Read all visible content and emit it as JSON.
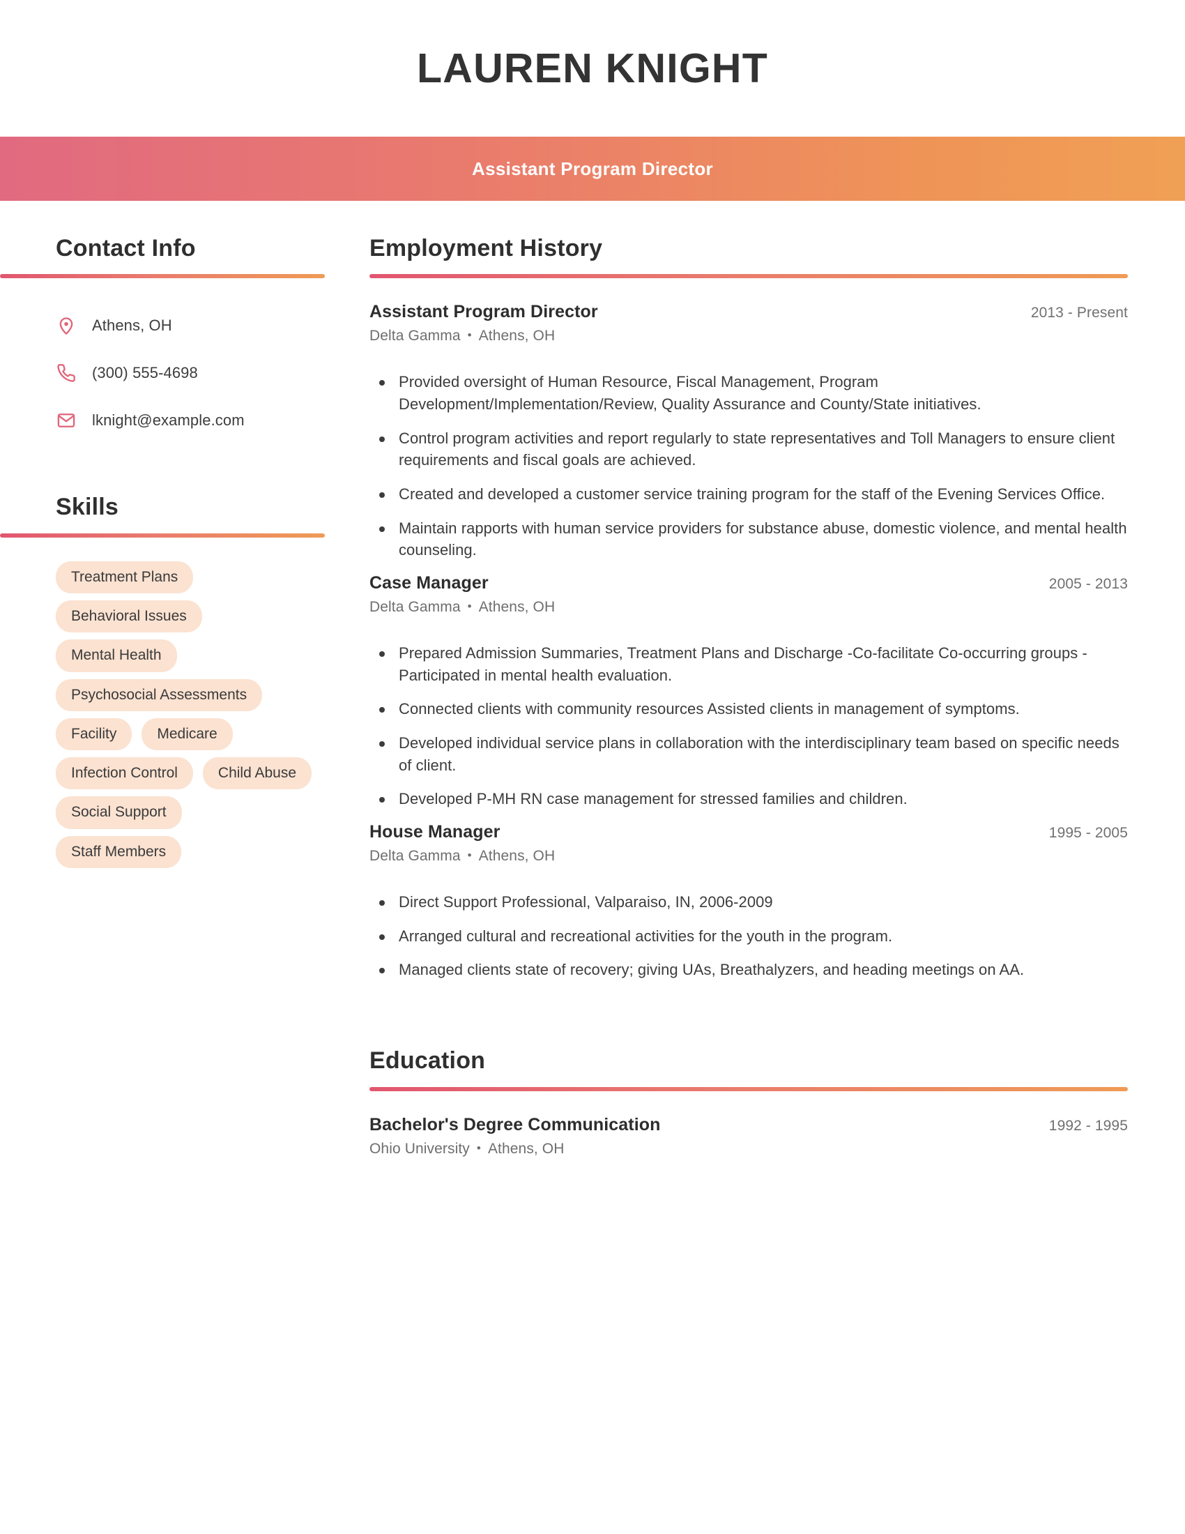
{
  "header": {
    "name": "LAUREN KNIGHT",
    "role": "Assistant Program Director"
  },
  "sidebar": {
    "contact": {
      "title": "Contact Info",
      "items": [
        {
          "icon": "location-pin-icon",
          "value": "Athens, OH"
        },
        {
          "icon": "phone-icon",
          "value": "(300) 555-4698"
        },
        {
          "icon": "envelope-icon",
          "value": "lknight@example.com"
        }
      ]
    },
    "skills": {
      "title": "Skills",
      "items": [
        "Treatment Plans",
        "Behavioral Issues",
        "Mental Health",
        "Psychosocial Assessments",
        "Facility",
        "Medicare",
        "Infection Control",
        "Child Abuse",
        "Social Support",
        "Staff Members"
      ]
    }
  },
  "main": {
    "employment": {
      "title": "Employment History",
      "entries": [
        {
          "title": "Assistant Program Director",
          "dates": "2013 - Present",
          "company": "Delta Gamma",
          "location": "Athens, OH",
          "bullets": [
            "Provided oversight of Human Resource, Fiscal Management, Program Development/Implementation/Review, Quality Assurance and County/State initiatives.",
            "Control program activities and report regularly to state representatives and Toll Managers to ensure client requirements and fiscal goals are achieved.",
            "Created and developed a customer service training program for the staff of the Evening Services Office.",
            "Maintain rapports with human service providers for substance abuse, domestic violence, and mental health counseling."
          ]
        },
        {
          "title": "Case Manager",
          "dates": "2005 - 2013",
          "company": "Delta Gamma",
          "location": "Athens, OH",
          "bullets": [
            "Prepared Admission Summaries, Treatment Plans and Discharge -Co-facilitate Co-occurring groups -Participated in mental health evaluation.",
            "Connected clients with community resources Assisted clients in management of symptoms.",
            "Developed individual service plans in collaboration with the interdisciplinary team based on specific needs of client.",
            "Developed P-MH RN case management for stressed families and children."
          ]
        },
        {
          "title": "House Manager",
          "dates": "1995 - 2005",
          "company": "Delta Gamma",
          "location": "Athens, OH",
          "bullets": [
            "Direct Support Professional, Valparaiso, IN, 2006-2009",
            "Arranged cultural and recreational activities for the youth in the program.",
            "Managed clients state of recovery; giving UAs, Breathalyzers, and heading meetings on AA."
          ]
        }
      ]
    },
    "education": {
      "title": "Education",
      "entries": [
        {
          "title": "Bachelor's Degree Communication",
          "dates": "1992 - 1995",
          "school": "Ohio University",
          "location": "Athens, OH"
        }
      ]
    }
  },
  "theme": {
    "gradient_start": "#e1566f",
    "gradient_end": "#ef9b55",
    "icon_color": "#e0657a",
    "pill_background": "#fbe2d1",
    "heading_color": "#2f2f2f",
    "bullet_separator": "•"
  }
}
